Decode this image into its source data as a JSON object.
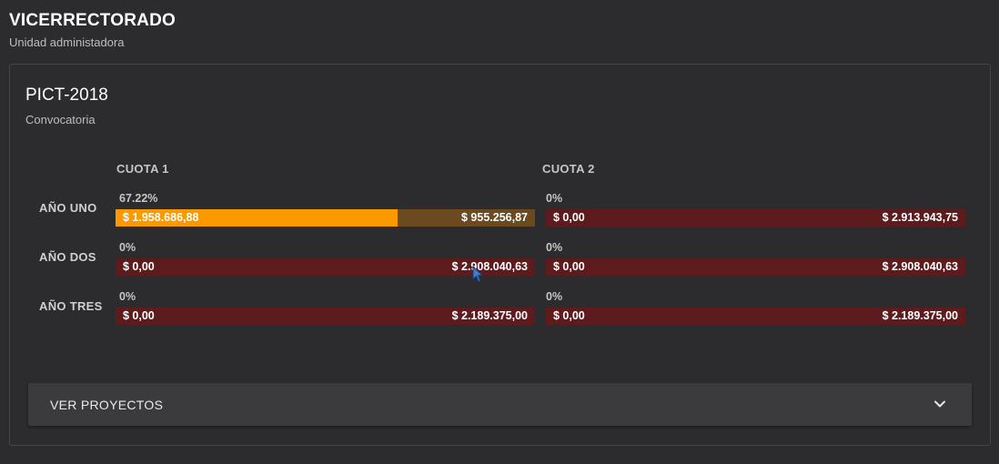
{
  "header": {
    "title": "VICERRECTORADO",
    "subtitle": "Unidad administadora"
  },
  "card": {
    "title": "PICT-2018",
    "subtitle": "Convocatoria",
    "columns": [
      "CUOTA 1",
      "CUOTA 2"
    ],
    "rows": [
      {
        "label": "AÑO UNO",
        "cells": [
          {
            "percent": "67.22%",
            "fill_fraction": 0.6722,
            "paid": "$ 1.958.686,88",
            "due": "$ 955.256,87"
          },
          {
            "percent": "0%",
            "fill_fraction": 0,
            "paid": "$ 0,00",
            "due": "$ 2.913.943,75"
          }
        ]
      },
      {
        "label": "AÑO DOS",
        "cells": [
          {
            "percent": "0%",
            "fill_fraction": 0,
            "paid": "$ 0,00",
            "due": "$ 2.908.040,63"
          },
          {
            "percent": "0%",
            "fill_fraction": 0,
            "paid": "$ 0,00",
            "due": "$ 2.908.040,63"
          }
        ]
      },
      {
        "label": "AÑO TRES",
        "cells": [
          {
            "percent": "0%",
            "fill_fraction": 0,
            "paid": "$ 0,00",
            "due": "$ 2.189.375,00"
          },
          {
            "percent": "0%",
            "fill_fraction": 0,
            "paid": "$ 0,00",
            "due": "$ 2.189.375,00"
          }
        ]
      }
    ],
    "expander_label": "VER PROYECTOS",
    "expander_icon": "chevron-down-icon"
  },
  "colors": {
    "paid_fill": "#fb9a00",
    "partial_remaining": "#6c4a20",
    "unpaid": "#5e1b1e",
    "background": "#2c2c2e"
  }
}
